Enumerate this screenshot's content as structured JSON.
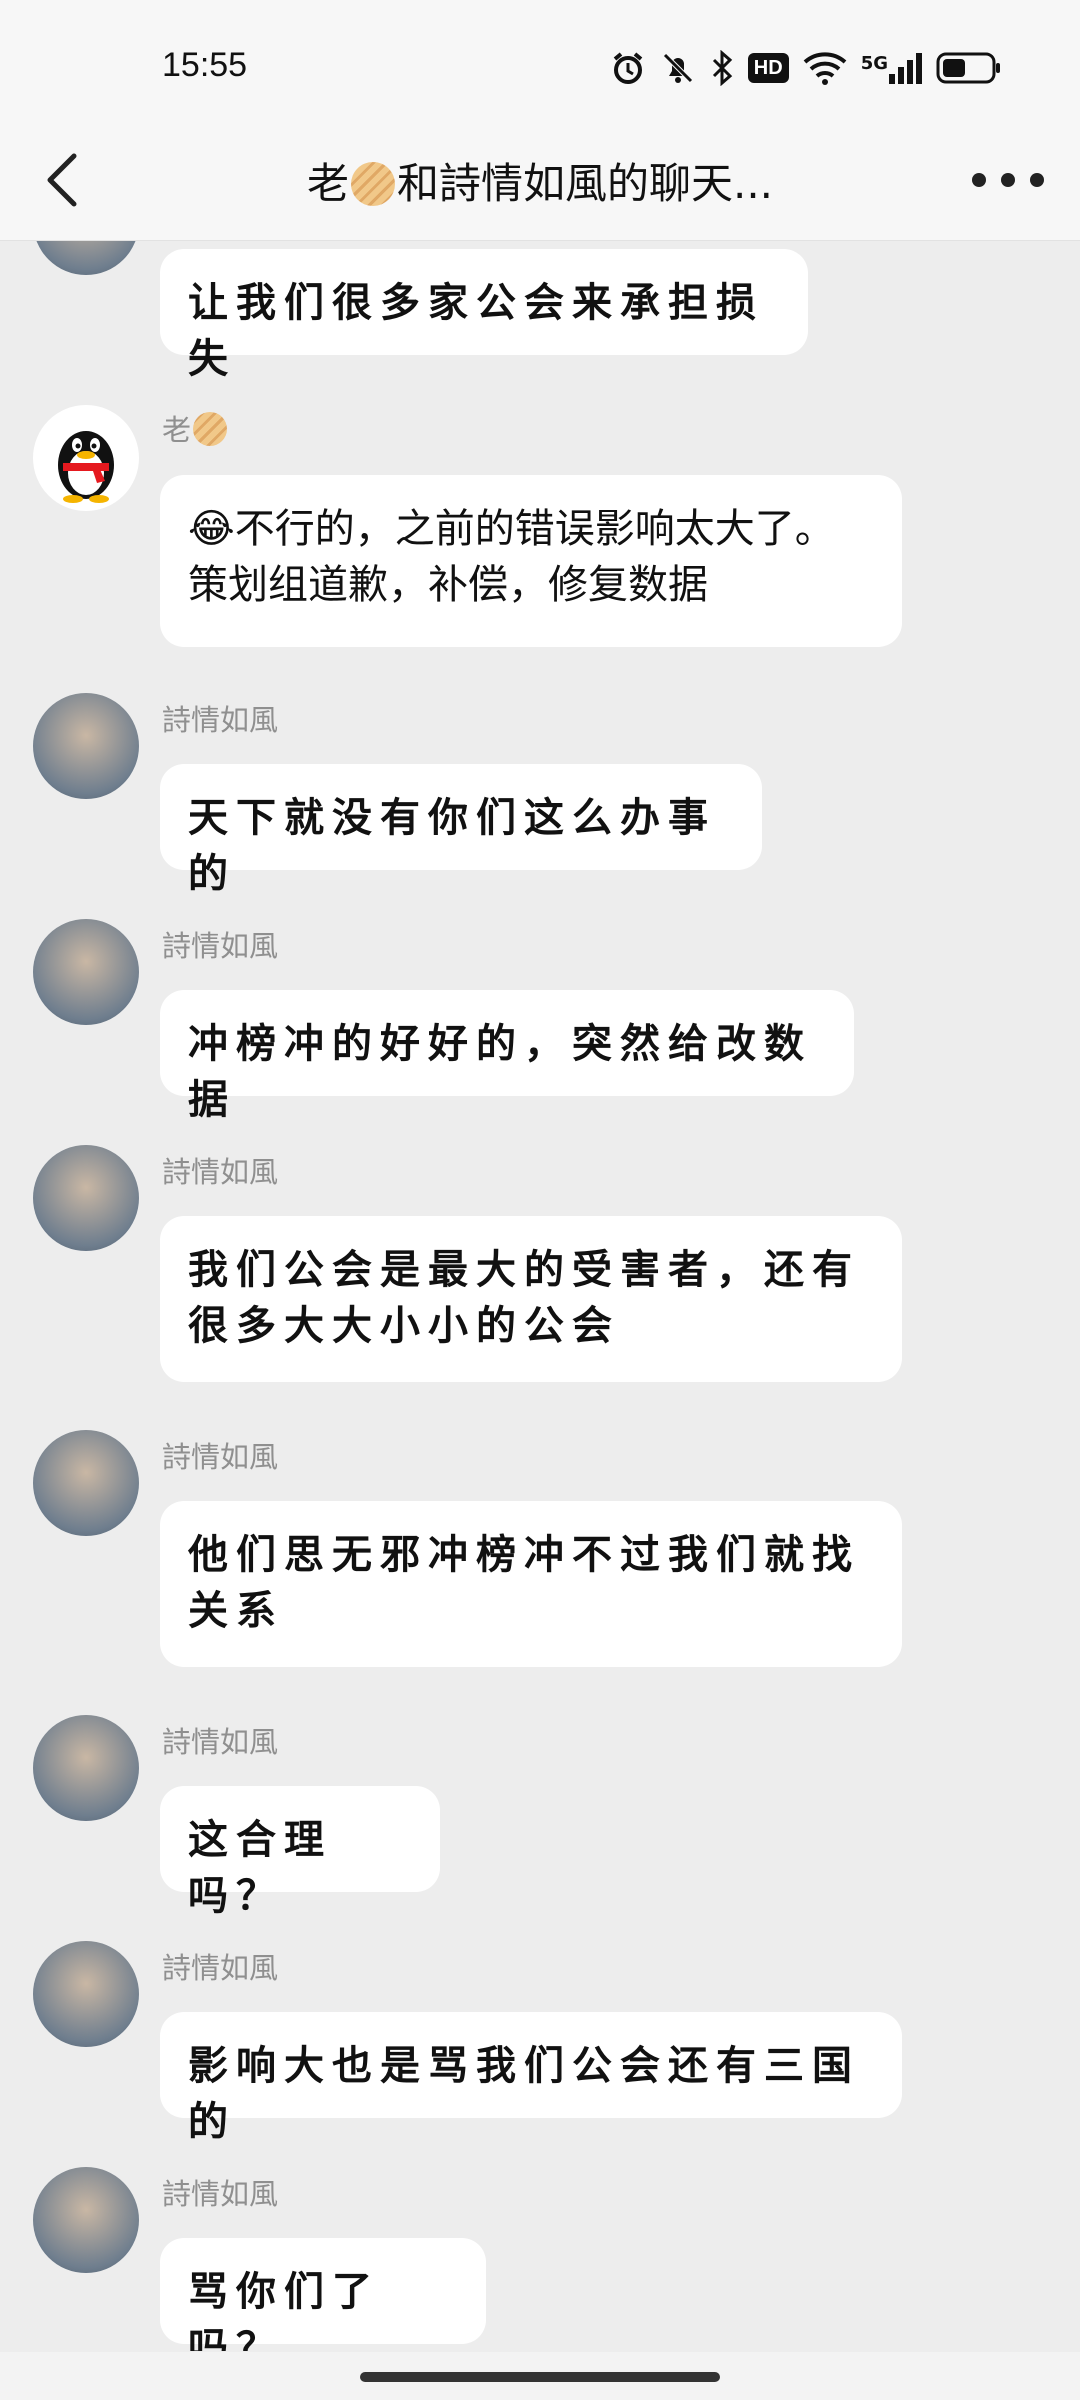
{
  "status_bar": {
    "time": "15:55",
    "network_label": "5G",
    "hd_label": "HD",
    "icons": [
      "alarm-icon",
      "silent-bell-icon",
      "bluetooth-icon",
      "hd-icon",
      "wifi-icon",
      "signal-icon",
      "battery-icon"
    ]
  },
  "header": {
    "title_prefix": "老",
    "title_suffix": "和詩情如風的聊天...",
    "back_icon": "chevron-left-icon",
    "more_icon": "more-dots-icon"
  },
  "messages": [
    {
      "sender": "",
      "text": "让我们很多家公会来承担损失",
      "avatar": "couple-photo"
    },
    {
      "sender": "老",
      "emoji": "😂",
      "text": "不行的，之前的错误影响太大了。策划组道歉，补偿，修复数据",
      "avatar": "qq-penguin"
    },
    {
      "sender": "詩情如風",
      "text": "天下就没有你们这么办事的",
      "avatar": "couple-photo"
    },
    {
      "sender": "詩情如風",
      "text": "冲榜冲的好好的，突然给改数据",
      "avatar": "couple-photo"
    },
    {
      "sender": "詩情如風",
      "text": "我们公会是最大的受害者，还有很多大大小小的公会",
      "avatar": "couple-photo"
    },
    {
      "sender": "詩情如風",
      "text": "他们思无邪冲榜冲不过我们就找关系",
      "avatar": "couple-photo"
    },
    {
      "sender": "詩情如風",
      "text": "这合理吗？",
      "avatar": "couple-photo"
    },
    {
      "sender": "詩情如風",
      "text": "影响大也是骂我们公会还有三国的",
      "avatar": "couple-photo"
    },
    {
      "sender": "詩情如風",
      "text": "骂你们了吗？",
      "avatar": "couple-photo"
    }
  ],
  "colors": {
    "background": "#ededed",
    "bubble": "#ffffff",
    "sender_name": "#8f8f8f",
    "text": "#111111"
  }
}
